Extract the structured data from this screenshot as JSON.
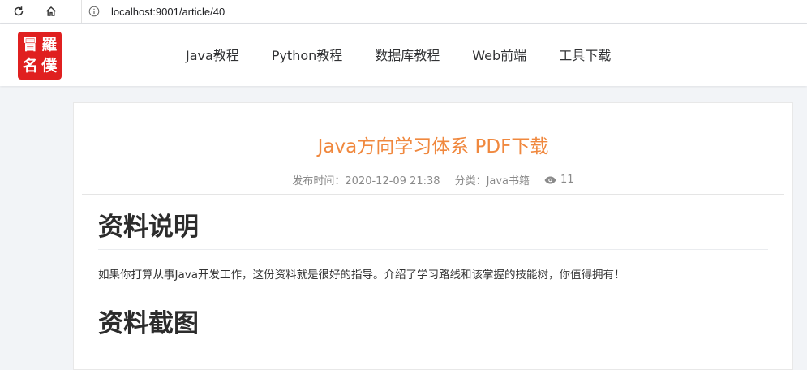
{
  "browser": {
    "reload_icon": "reload-icon",
    "home_icon": "home-icon",
    "info_icon": "info-icon",
    "url": "localhost:9001/article/40"
  },
  "site": {
    "logo_chars": [
      "羅",
      "冒",
      "僕",
      "名"
    ],
    "nav": [
      {
        "label": "Java教程"
      },
      {
        "label": "Python教程"
      },
      {
        "label": "数据库教程"
      },
      {
        "label": "Web前端"
      },
      {
        "label": "工具下载"
      }
    ]
  },
  "article": {
    "title": "Java方向学习体系 PDF下载",
    "publish_label": "发布时间：2020-12-09 21:38",
    "category_label": "分类：Java书籍",
    "views": "11",
    "sections": [
      {
        "heading": "资料说明",
        "text": "如果你打算从事Java开发工作，这份资料就是很好的指导。介绍了学习路线和该掌握的技能树，你值得拥有！"
      },
      {
        "heading": "资料截图"
      }
    ]
  },
  "colors": {
    "title": "#f0883e",
    "logo": "#e02020",
    "background": "#f2f4f7"
  }
}
